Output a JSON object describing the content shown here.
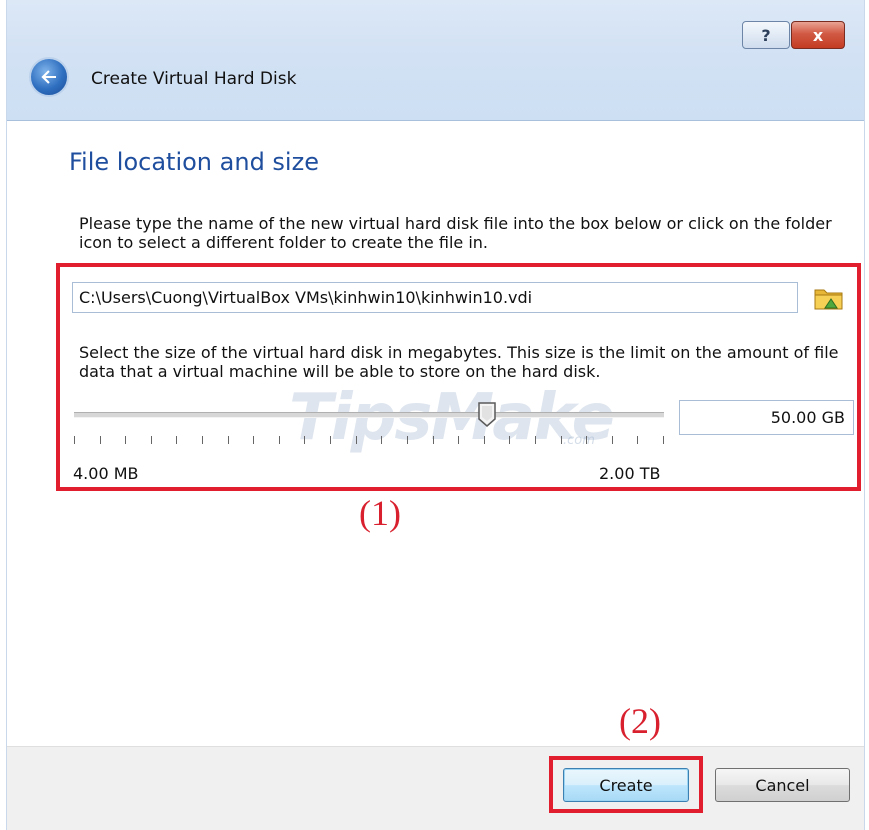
{
  "window": {
    "help_label": "?",
    "close_label": "x",
    "title": "Create Virtual Hard Disk"
  },
  "page": {
    "heading": "File location and size",
    "location_description": "Please type the name of the new virtual hard disk file into the box below or click on the folder icon to select a different folder to create the file in.",
    "file_path": "C:\\Users\\Cuong\\VirtualBox VMs\\kinhwin10\\kinhwin10.vdi",
    "size_description": "Select the size of the virtual hard disk in megabytes. This size is the limit on the amount of file data that a virtual machine will be able to store on the hard disk.",
    "size_value": "50.00 GB",
    "slider_min_label": "4.00 MB",
    "slider_max_label": "2.00 TB",
    "slider_position_fraction": 0.7
  },
  "annotations": {
    "label1": "(1)",
    "label2": "(2)",
    "highlight_color": "#e01e2e"
  },
  "watermark": {
    "text": "TipsMake",
    "suffix": ".com"
  },
  "footer": {
    "create_label": "Create",
    "cancel_label": "Cancel"
  },
  "icons": {
    "back": "back-arrow-icon",
    "folder": "folder-icon",
    "help": "help-icon",
    "close": "close-icon"
  },
  "colors": {
    "heading": "#1f4e9e",
    "titlebar": "#d3e2f4",
    "close_button": "#c43b22"
  }
}
